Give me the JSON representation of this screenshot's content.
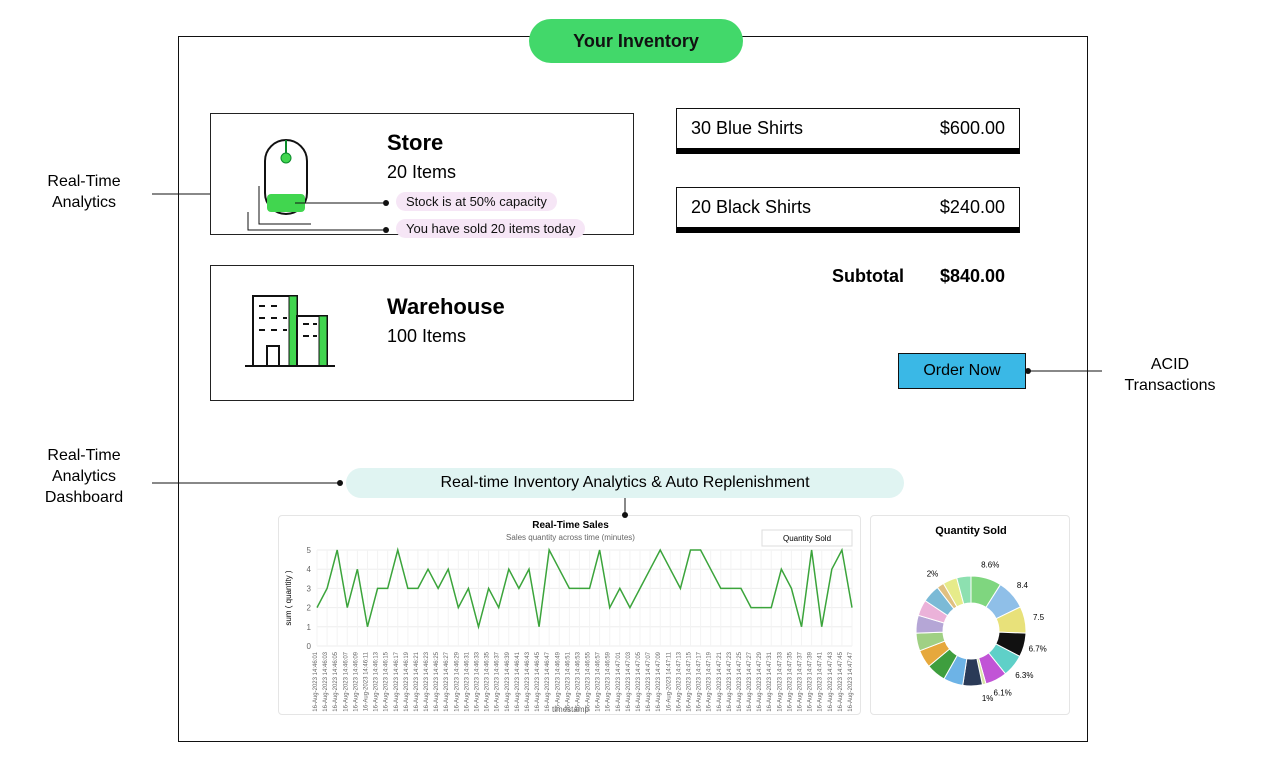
{
  "header": {
    "title": "Your Inventory"
  },
  "callouts": {
    "realtime": "Real-Time\nAnalytics",
    "dashboard": "Real-Time\nAnalytics\nDashboard",
    "acid": "ACID\nTransactions"
  },
  "store": {
    "title": "Store",
    "items": "20 Items",
    "pill1": "Stock is at 50% capacity",
    "pill2": "You have sold 20 items today"
  },
  "warehouse": {
    "title": "Warehouse",
    "items": "100 Items"
  },
  "cart": {
    "items": [
      {
        "label": "30 Blue Shirts",
        "price": "$600.00"
      },
      {
        "label": "20 Black Shirts",
        "price": "$240.00"
      }
    ],
    "subtotal_label": "Subtotal",
    "subtotal": "$840.00"
  },
  "order_button": "Order Now",
  "analytics_chip": "Real-time Inventory Analytics & Auto Replenishment",
  "chart_data": [
    {
      "type": "line",
      "title": "Real-Time Sales",
      "subtitle": "Sales quantity across time (minutes)",
      "ylabel": "sum ( quantity )",
      "xlabel": "timestamp",
      "legend": "Quantity Sold",
      "ylim": [
        0,
        5
      ],
      "categories": [
        "16-Aug-2023 14:46:01",
        "16-Aug-2023 14:46:03",
        "16-Aug-2023 14:46:05",
        "16-Aug-2023 14:46:07",
        "16-Aug-2023 14:46:09",
        "16-Aug-2023 14:46:11",
        "16-Aug-2023 14:46:13",
        "16-Aug-2023 14:46:15",
        "16-Aug-2023 14:46:17",
        "16-Aug-2023 14:46:19",
        "16-Aug-2023 14:46:21",
        "16-Aug-2023 14:46:23",
        "16-Aug-2023 14:46:25",
        "16-Aug-2023 14:46:27",
        "16-Aug-2023 14:46:29",
        "16-Aug-2023 14:46:31",
        "16-Aug-2023 14:46:33",
        "16-Aug-2023 14:46:35",
        "16-Aug-2023 14:46:37",
        "16-Aug-2023 14:46:39",
        "16-Aug-2023 14:46:41",
        "16-Aug-2023 14:46:43",
        "16-Aug-2023 14:46:45",
        "16-Aug-2023 14:46:47",
        "16-Aug-2023 14:46:49",
        "16-Aug-2023 14:46:51",
        "16-Aug-2023 14:46:53",
        "16-Aug-2023 14:46:55",
        "16-Aug-2023 14:46:57",
        "16-Aug-2023 14:46:59",
        "16-Aug-2023 14:47:01",
        "16-Aug-2023 14:47:03",
        "16-Aug-2023 14:47:05",
        "16-Aug-2023 14:47:07",
        "16-Aug-2023 14:47:09",
        "16-Aug-2023 14:47:11",
        "16-Aug-2023 14:47:13",
        "16-Aug-2023 14:47:15",
        "16-Aug-2023 14:47:17",
        "16-Aug-2023 14:47:19",
        "16-Aug-2023 14:47:21",
        "16-Aug-2023 14:47:23",
        "16-Aug-2023 14:47:25",
        "16-Aug-2023 14:47:27",
        "16-Aug-2023 14:47:29",
        "16-Aug-2023 14:47:31",
        "16-Aug-2023 14:47:33",
        "16-Aug-2023 14:47:35",
        "16-Aug-2023 14:47:37",
        "16-Aug-2023 14:47:39",
        "16-Aug-2023 14:47:41",
        "16-Aug-2023 14:47:43",
        "16-Aug-2023 14:47:45",
        "16-Aug-2023 14:47:47"
      ],
      "values": [
        2,
        3,
        5,
        2,
        4,
        1,
        3,
        3,
        5,
        3,
        3,
        4,
        3,
        4,
        2,
        3,
        1,
        3,
        2,
        4,
        3,
        4,
        1,
        5,
        4,
        3,
        3,
        3,
        5,
        2,
        3,
        2,
        3,
        4,
        5,
        4,
        3,
        5,
        5,
        4,
        3,
        3,
        3,
        2,
        2,
        2,
        4,
        3,
        1,
        5,
        1,
        4,
        5,
        2
      ]
    },
    {
      "type": "pie",
      "title": "Quantity Sold",
      "slices": [
        {
          "label": "8.6%",
          "value": 8.6,
          "color": "#7fd67f"
        },
        {
          "label": "8.4",
          "value": 8.4,
          "color": "#8fbfe8"
        },
        {
          "label": "7.5",
          "value": 7.5,
          "color": "#e8e17a"
        },
        {
          "label": "6.7%",
          "value": 6.7,
          "color": "#111111"
        },
        {
          "label": "6.3%",
          "value": 6.3,
          "color": "#5fd0c8"
        },
        {
          "label": "6.1%",
          "value": 6.1,
          "color": "#c154d6"
        },
        {
          "label": "1%",
          "value": 1.0,
          "color": "#d7e4a3"
        },
        {
          "label": "",
          "value": 5.5,
          "color": "#2a3a57"
        },
        {
          "label": "",
          "value": 5.5,
          "color": "#6db3e6"
        },
        {
          "label": "",
          "value": 5.5,
          "color": "#3e9e3e"
        },
        {
          "label": "",
          "value": 5.0,
          "color": "#e6a83c"
        },
        {
          "label": "",
          "value": 5.0,
          "color": "#a0d084"
        },
        {
          "label": "",
          "value": 5.0,
          "color": "#b5a6d6"
        },
        {
          "label": "",
          "value": 4.5,
          "color": "#ebb2d9"
        },
        {
          "label": "",
          "value": 5.0,
          "color": "#7bbad6"
        },
        {
          "label": "2%",
          "value": 2.0,
          "color": "#e0c080"
        },
        {
          "label": "",
          "value": 4.0,
          "color": "#e6eb8a"
        },
        {
          "label": "",
          "value": 4.0,
          "color": "#8de0b0"
        }
      ]
    }
  ]
}
